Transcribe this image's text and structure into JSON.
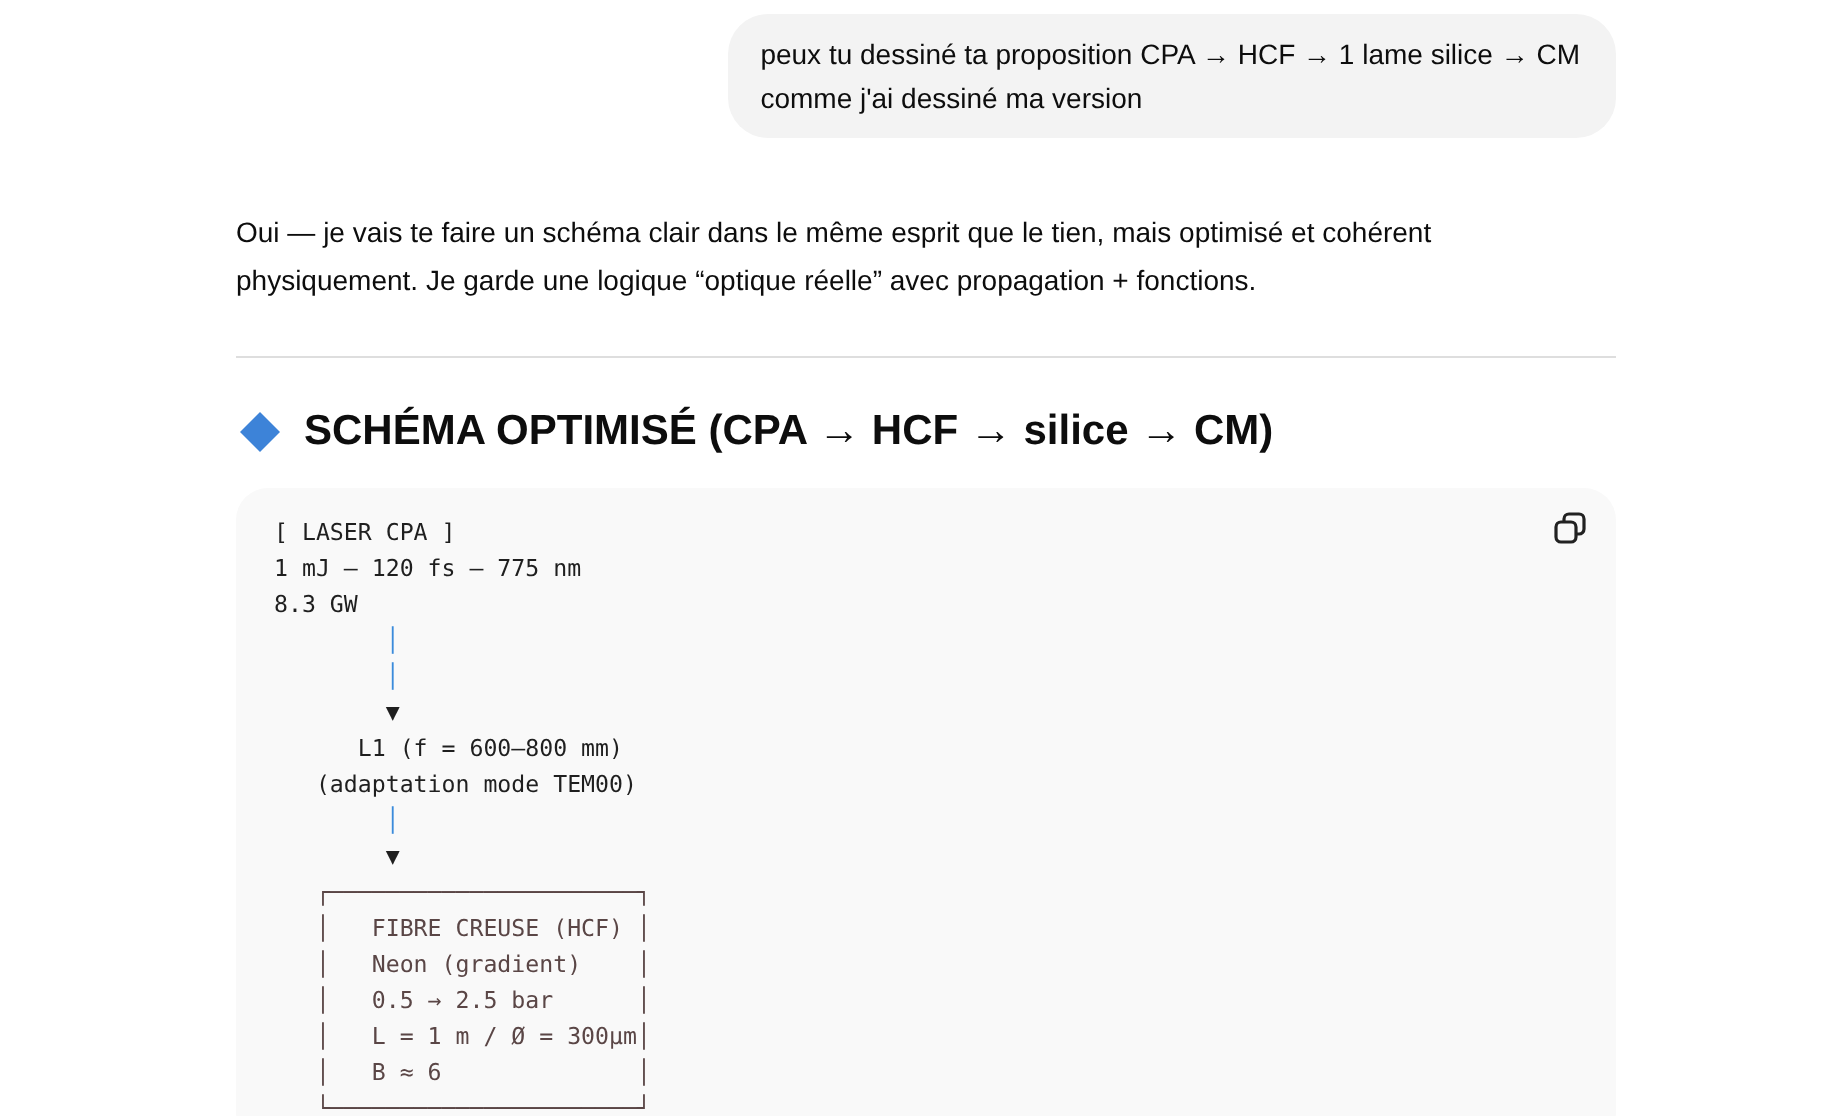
{
  "user_message": {
    "lines": [
      "peux tu dessiné ta proposition CPA → HCF → 1 lame silice → CM",
      "comme j'ai dessiné ma version"
    ]
  },
  "reply": {
    "paragraph": "Oui — je vais te faire un schéma clair dans le même esprit que le tien, mais optimisé et cohérent physiquement. Je garde une logique “optique réelle” avec propagation + fonctions.",
    "heading": "SCHÉMA OPTIMISÉ (CPA → HCF → silice → CM)",
    "code_lines": [
      {
        "kind": "text",
        "text": "[ LASER CPA ]"
      },
      {
        "kind": "text",
        "text": "1 mJ – 120 fs – 775 nm"
      },
      {
        "kind": "text",
        "text": "8.3 GW"
      },
      {
        "kind": "flow",
        "text": "        │"
      },
      {
        "kind": "flow",
        "text": "        │"
      },
      {
        "kind": "text",
        "text": "        ▼"
      },
      {
        "kind": "text",
        "text": "      L1 (f = 600–800 mm)"
      },
      {
        "kind": "text",
        "text": "   (adaptation mode TEM00)"
      },
      {
        "kind": "flow",
        "text": "        │"
      },
      {
        "kind": "text",
        "text": "        ▼"
      },
      {
        "kind": "box",
        "text": "   ┌──────────────────────┐"
      },
      {
        "kind": "box",
        "text": "   │   FIBRE CREUSE (HCF) │"
      },
      {
        "kind": "box",
        "text": "   │   Neon (gradient)    │"
      },
      {
        "kind": "box",
        "text": "   │   0.5 → 2.5 bar      │"
      },
      {
        "kind": "box",
        "text": "   │   L = 1 m / Ø = 300µm│"
      },
      {
        "kind": "box",
        "text": "   │   B ≈ 6              │"
      },
      {
        "kind": "box",
        "text": "   └──────────────────────┘"
      }
    ]
  }
}
